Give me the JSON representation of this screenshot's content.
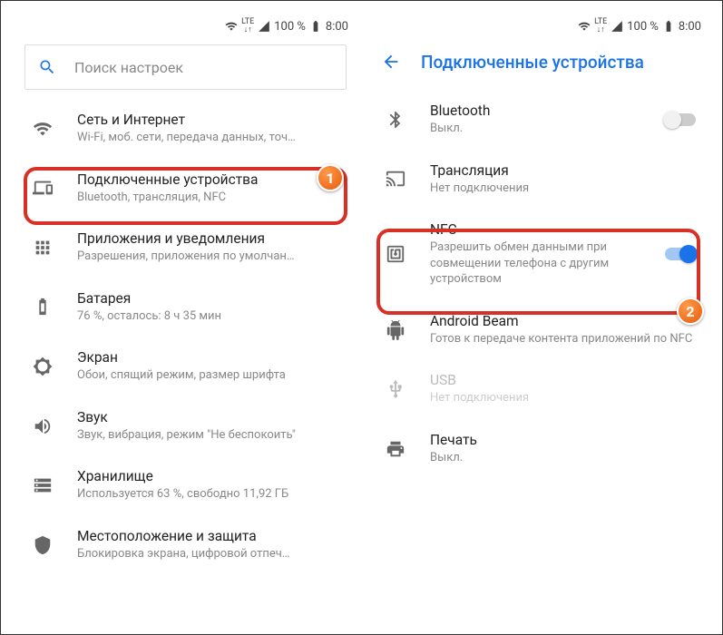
{
  "status": {
    "lte_top": "LTE",
    "lte_arrows": "↓↑",
    "battery_pct": "100 %",
    "time": "8:00"
  },
  "left": {
    "search_placeholder": "Поиск настроек",
    "items": [
      {
        "title": "Сеть и Интернет",
        "subtitle": "Wi-Fi, моб. сети, передача данных, точ…"
      },
      {
        "title": "Подключенные устройства",
        "subtitle": "Bluetooth, трансляция, NFC"
      },
      {
        "title": "Приложения и уведомления",
        "subtitle": "Разрешения, приложения по умолчан…"
      },
      {
        "title": "Батарея",
        "subtitle": "76 %, осталось: 8 ч 35 мин"
      },
      {
        "title": "Экран",
        "subtitle": "Обои, спящий режим, размер шрифта"
      },
      {
        "title": "Звук",
        "subtitle": "Звук, вибрация, режим \"Не беспокоить\""
      },
      {
        "title": "Хранилище",
        "subtitle": "Используется 63 %, свободно 11,92 ГБ"
      },
      {
        "title": "Местоположение и защита",
        "subtitle": "Блокировка экрана, цифровой отпеч…"
      }
    ]
  },
  "right": {
    "header": "Подключенные устройства",
    "items": [
      {
        "title": "Bluetooth",
        "subtitle": "Выкл."
      },
      {
        "title": "Трансляция",
        "subtitle": "Нет подключения"
      },
      {
        "title": "NFC",
        "subtitle": "Разрешить обмен данными при совмещении телефона с другим устройством"
      },
      {
        "title": "Android Beam",
        "subtitle": "Готов к передаче контента приложений по NFC"
      },
      {
        "title": "USB",
        "subtitle": "Нет подключения"
      },
      {
        "title": "Печать",
        "subtitle": "Выкл."
      }
    ]
  },
  "callouts": {
    "one": "1",
    "two": "2"
  }
}
